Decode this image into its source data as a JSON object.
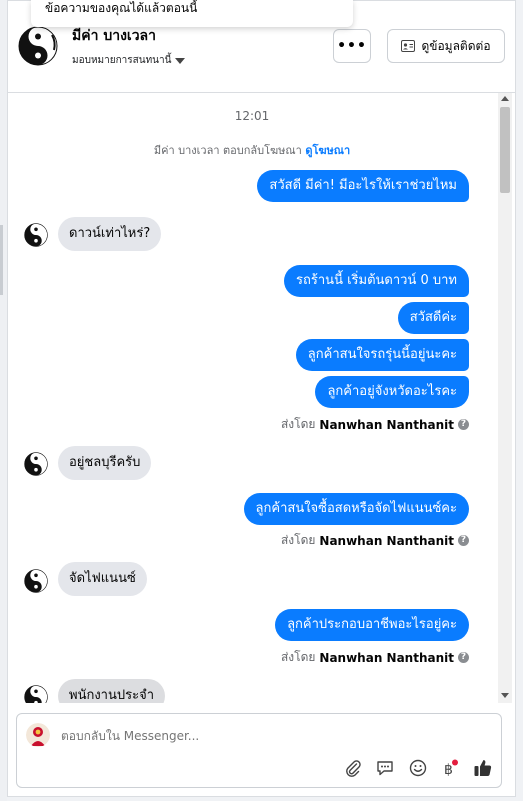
{
  "tooltip_text": "ข้อความของคุณได้แล้วตอนนี้",
  "header": {
    "contact_name": "มีค่า บางเวลา",
    "assign_label": "มอบหมายการสนทนานี้",
    "more_label": "•••",
    "contact_info_label": "ดูข้อมูลติดต่อ"
  },
  "thread": {
    "time": "12:01",
    "ad_reply_text": "มีค่า บางเวลา ตอบกลับโฆษณา",
    "ad_link": "ดูโฆษณา",
    "messages": [
      {
        "dir": "out",
        "text": "สวัสดี มีค่า! มีอะไรให้เราช่วยไหม"
      },
      {
        "dir": "in",
        "text": "ดาวน์เท่าไหร่?"
      },
      {
        "dir": "out",
        "text": "รถร้านนี้ เริ่มต้นดาวน์ 0 บาท"
      },
      {
        "dir": "out",
        "text": "สวัสดีค่ะ"
      },
      {
        "dir": "out",
        "text": "ลูกค้าสนใจรถรุ่นนี้อยู่นะคะ"
      },
      {
        "dir": "out",
        "text": "ลูกค้าอยู่จังหวัดอะไรคะ"
      },
      {
        "dir": "in",
        "text": "อยู่ชลบุรีครับ"
      },
      {
        "dir": "out",
        "text": "ลูกค้าสนใจซื้อสดหรือจัดไฟแนนซ์คะ"
      },
      {
        "dir": "in",
        "text": "จัดไฟแนนซ์"
      },
      {
        "dir": "out",
        "text": "ลูกค้าประกอบอาชีพอะไรอยู่คะ"
      },
      {
        "dir": "in",
        "text": "พนักงานประจำ"
      }
    ],
    "sent_by_prefix": "ส่งโดย",
    "sent_by_name": "Nanwhan Nanthanit",
    "help_glyph": "?"
  },
  "composer": {
    "placeholder": "ตอบกลับใน Messenger...",
    "tools": [
      "paperclip-icon",
      "chat-bubble-icon",
      "emoji-icon",
      "baht-icon",
      "thumbs-up-icon"
    ]
  },
  "colors": {
    "outgoing": "#0a7cff",
    "incoming": "#e4e6eb",
    "link": "#0a7cff",
    "notification_dot": "#e41e3f"
  }
}
